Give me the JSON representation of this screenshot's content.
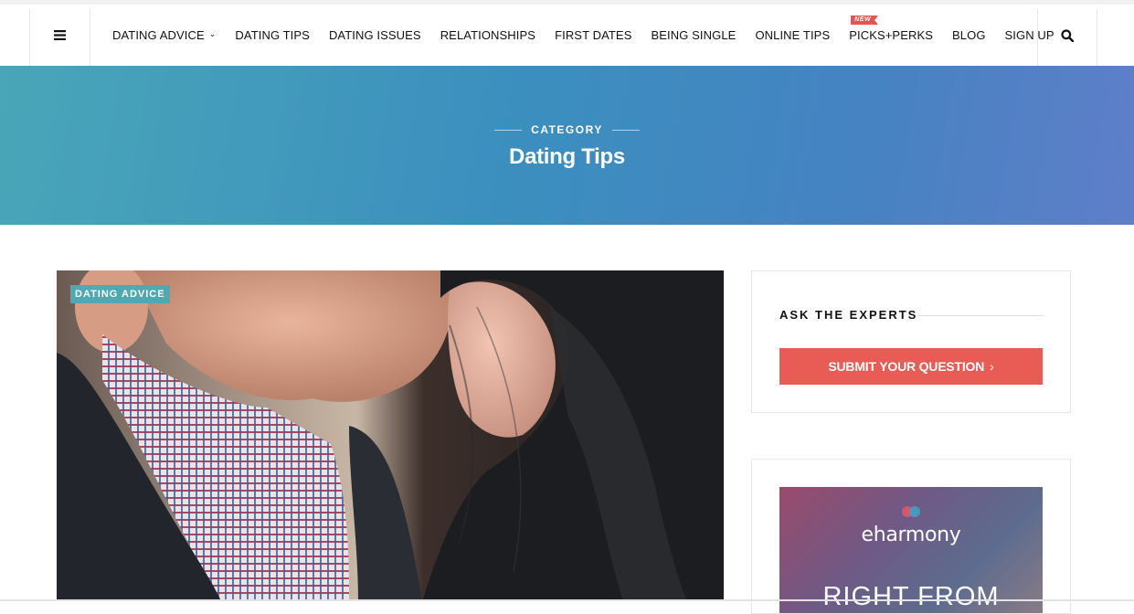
{
  "header": {
    "menu_icon": "hamburger-menu-icon",
    "search_icon": "search-icon",
    "nav": [
      {
        "label": "DATING ADVICE",
        "has_dropdown": true
      },
      {
        "label": "DATING TIPS"
      },
      {
        "label": "DATING ISSUES"
      },
      {
        "label": "RELATIONSHIPS"
      },
      {
        "label": "FIRST DATES"
      },
      {
        "label": "BEING SINGLE"
      },
      {
        "label": "ONLINE TIPS"
      },
      {
        "label": "PICKS+PERKS",
        "badge": "NEW"
      },
      {
        "label": "BLOG"
      },
      {
        "label": "SIGN UP"
      }
    ]
  },
  "hero": {
    "kicker": "CATEGORY",
    "title": "Dating Tips"
  },
  "feature": {
    "tag": "DATING ADVICE"
  },
  "sidebar": {
    "experts_title": "ASK THE EXPERTS",
    "submit_label": "SUBMIT YOUR QUESTION",
    "ad": {
      "brand": "eharmony",
      "headline": "RIGHT FROM"
    }
  },
  "colors": {
    "accent_button": "#e95c56",
    "tag": "#4fa9b3",
    "hero_start": "#49a6b8",
    "hero_end": "#5f7ec9"
  }
}
